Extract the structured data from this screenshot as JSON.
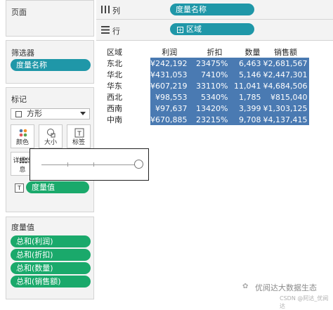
{
  "left": {
    "pages_title": "页面",
    "filters_title": "筛选器",
    "filter_pill": "度量名称",
    "marks_title": "标记",
    "mark_type": "方形",
    "mark_buttons": [
      {
        "label": "颜色",
        "icon": "color-dots-icon"
      },
      {
        "label": "大小",
        "icon": "size-shapes-icon"
      },
      {
        "label": "标签",
        "icon": "label-T-icon"
      },
      {
        "label": "详细信息",
        "icon": "detail-dots-icon"
      }
    ],
    "text_pill": "度量值",
    "measures_title": "度量值",
    "measures": [
      "总和(利润)",
      "总和(折扣)",
      "总和(数量)",
      "总和(销售额)"
    ]
  },
  "shelves": {
    "columns_label": "列",
    "columns_pill": "度量名称",
    "rows_label": "行",
    "rows_pill": "区域"
  },
  "table": {
    "headers": [
      "区域",
      "利润",
      "折扣",
      "数量",
      "销售额"
    ],
    "rows": [
      {
        "region": "东北",
        "profit": "¥242,192",
        "discount": "23475%",
        "qty": "6,463",
        "sales": "¥2,681,567"
      },
      {
        "region": "华北",
        "profit": "¥431,053",
        "discount": "7410%",
        "qty": "5,146",
        "sales": "¥2,447,301"
      },
      {
        "region": "华东",
        "profit": "¥607,219",
        "discount": "33110%",
        "qty": "11,041",
        "sales": "¥4,684,506"
      },
      {
        "region": "西北",
        "profit": "¥98,553",
        "discount": "5340%",
        "qty": "1,785",
        "sales": "¥815,040"
      },
      {
        "region": "西南",
        "profit": "¥97,637",
        "discount": "13420%",
        "qty": "3,399",
        "sales": "¥1,303,125"
      },
      {
        "region": "中南",
        "profit": "¥670,885",
        "discount": "23215%",
        "qty": "9,708",
        "sales": "¥4,137,415"
      }
    ]
  },
  "watermark": {
    "main": "优阅达大数据生态",
    "csdn": "CSDN @阿达_优阅达"
  },
  "colors": {
    "pill_blue": "#1f97a8",
    "pill_green": "#1aa96b",
    "cell_blue": "#4a7ab2"
  }
}
